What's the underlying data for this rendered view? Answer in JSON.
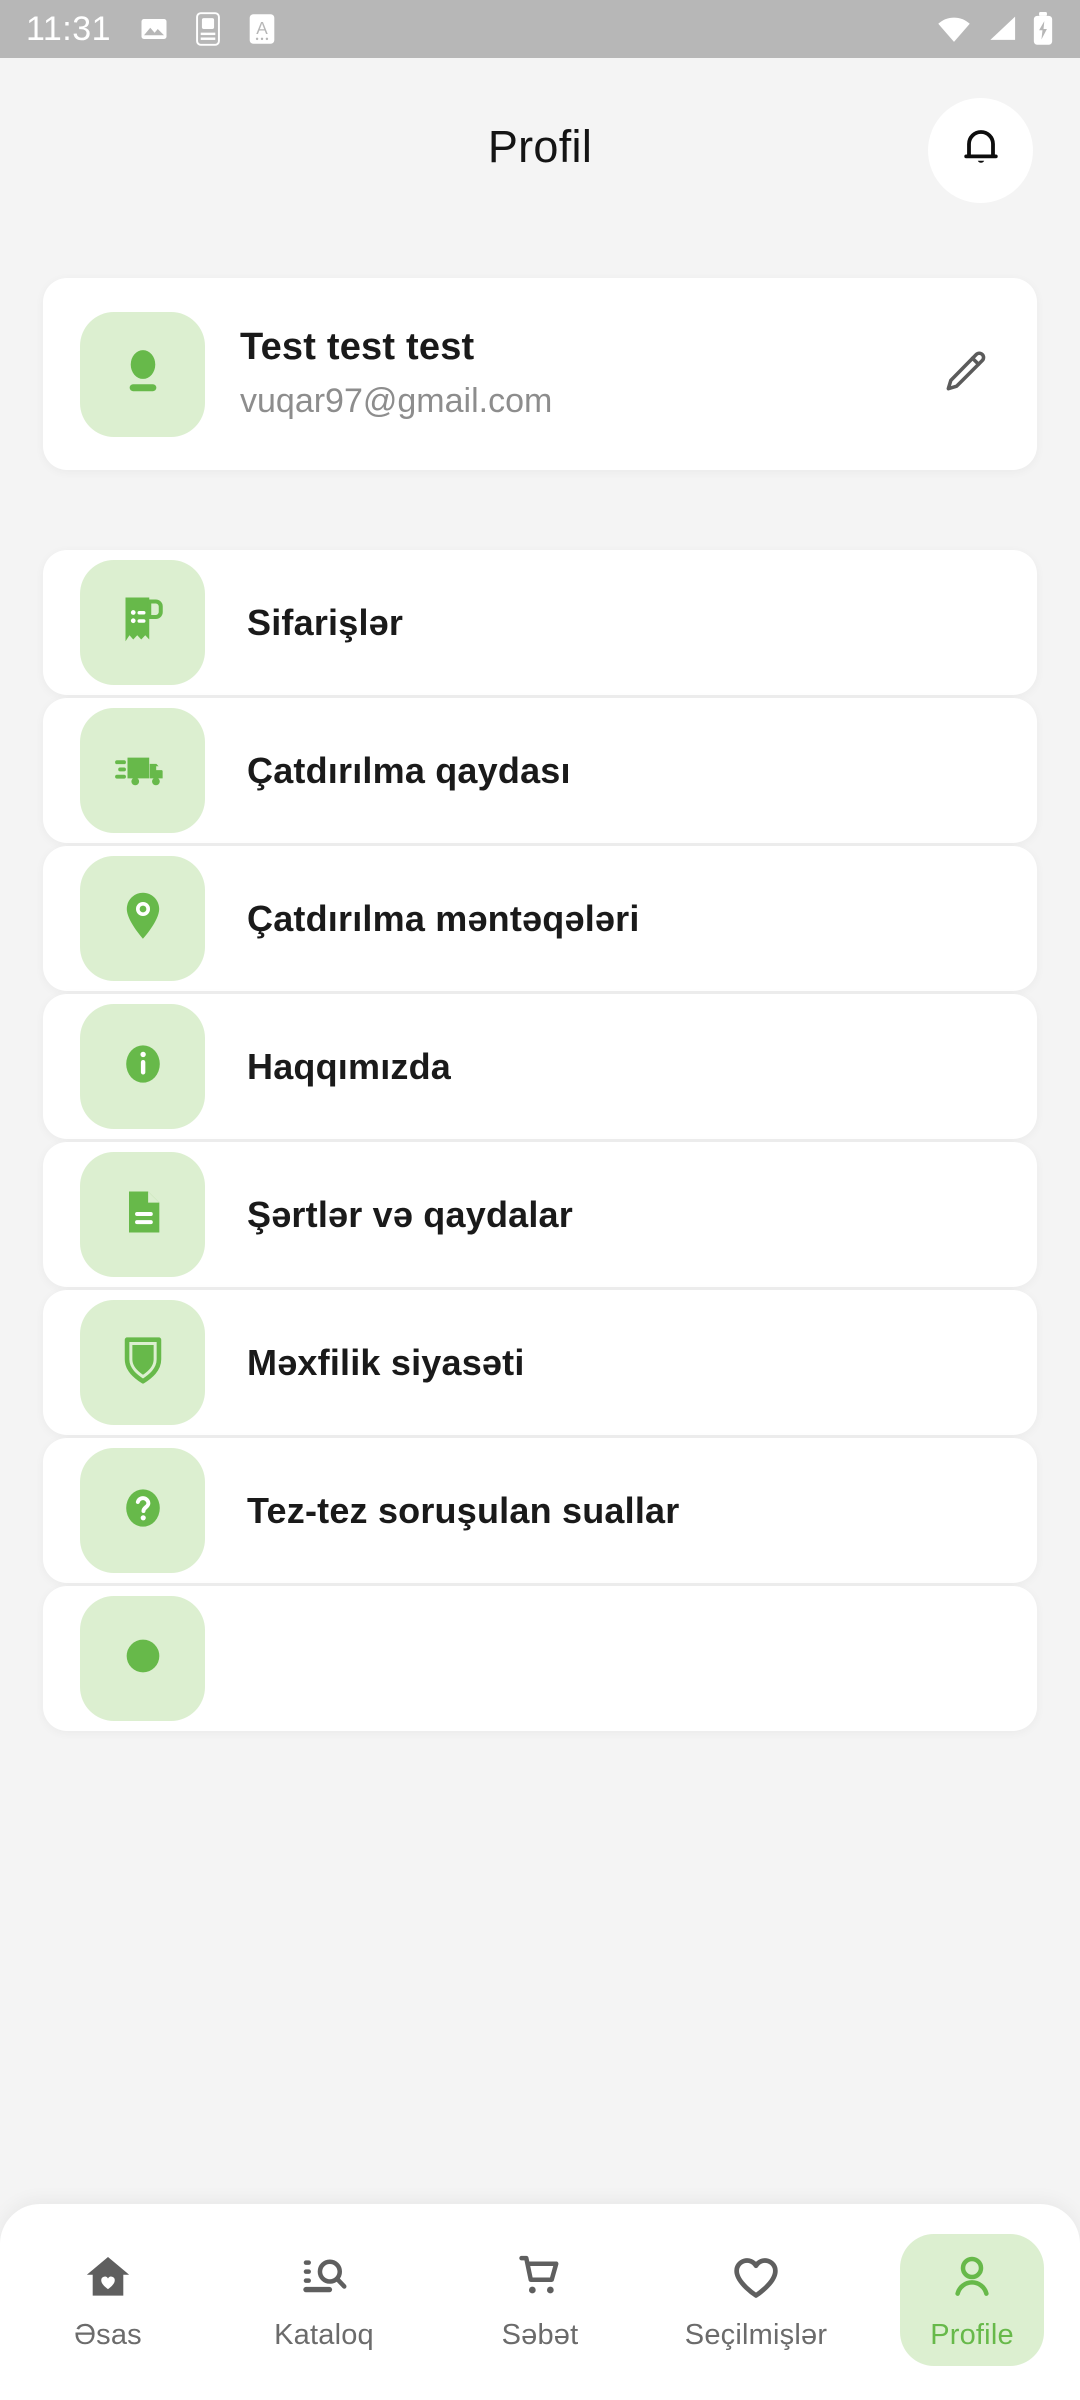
{
  "theme": {
    "accent_green": "#67b94a",
    "accent_green_soft": "#dcefd0",
    "page_background": "#f4f4f4",
    "card_background": "#ffffff",
    "status_bar_background": "#b7b7b7",
    "text_primary": "#1a1a1a",
    "text_muted": "#8d8d8d",
    "nav_inactive": "#6b6b6b"
  },
  "status_bar": {
    "clock": "11:31",
    "left_icons": [
      "image-icon",
      "sim-card-icon",
      "font-size-icon"
    ],
    "right_icons": [
      "wifi-icon",
      "cellular-signal-icon",
      "battery-charging-icon"
    ]
  },
  "header": {
    "title": "Profil",
    "notification_icon": "bell-icon"
  },
  "profile": {
    "avatar_icon": "user-avatar-icon",
    "name": "Test test test",
    "email": "vuqar97@gmail.com",
    "edit_icon": "pencil-icon"
  },
  "menu": {
    "items": [
      {
        "label": "Sifarişlər",
        "icon": "receipt-icon"
      },
      {
        "label": "Çatdırılma qaydası",
        "icon": "delivery-truck-icon"
      },
      {
        "label": "Çatdırılma məntəqələri",
        "icon": "map-pin-icon"
      },
      {
        "label": "Haqqımızda",
        "icon": "info-icon"
      },
      {
        "label": "Şərtlər və qaydalar",
        "icon": "document-icon"
      },
      {
        "label": "Məxfilik siyasəti",
        "icon": "shield-icon"
      },
      {
        "label": "Tez-tez soruşulan suallar",
        "icon": "question-mark-icon"
      },
      {
        "label": "",
        "icon": "partial-hidden-icon"
      }
    ]
  },
  "bottom_nav": {
    "items": [
      {
        "label": "Əsas",
        "icon": "home-heart-icon",
        "active": false
      },
      {
        "label": "Kataloq",
        "icon": "catalog-search-icon",
        "active": false
      },
      {
        "label": "Səbət",
        "icon": "shopping-cart-icon",
        "active": false
      },
      {
        "label": "Seçilmişlər",
        "icon": "heart-icon",
        "active": false
      },
      {
        "label": "Profile",
        "icon": "person-icon",
        "active": true
      }
    ]
  }
}
